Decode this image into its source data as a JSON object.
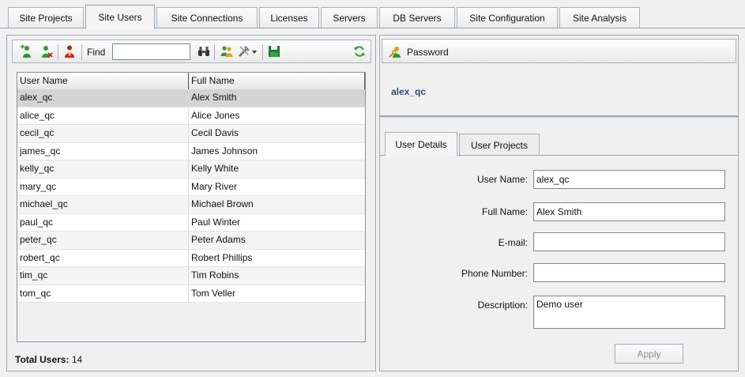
{
  "top_tabs": [
    {
      "label": "Site Projects"
    },
    {
      "label": "Site Users"
    },
    {
      "label": "Site Connections"
    },
    {
      "label": "Licenses"
    },
    {
      "label": "Servers"
    },
    {
      "label": "DB Servers"
    },
    {
      "label": "Site Configuration"
    },
    {
      "label": "Site Analysis"
    }
  ],
  "active_top_tab": "Site Users",
  "toolbar": {
    "find_label": "Find",
    "find_value": "",
    "icons": [
      "add-user-icon",
      "delete-user-icon",
      "user-properties-icon",
      "find-binoculars-icon",
      "users-group-icon",
      "tools-icon",
      "dropdown-arrow-icon",
      "save-icon",
      "refresh-icon"
    ]
  },
  "grid": {
    "headers": [
      "User Name",
      "Full Name"
    ],
    "rows": [
      [
        "alex_qc",
        "Alex Smith"
      ],
      [
        "alice_qc",
        "Alice Jones"
      ],
      [
        "cecil_qc",
        "Cecil Davis"
      ],
      [
        "james_qc",
        "James Johnson"
      ],
      [
        "kelly_qc",
        "Kelly White"
      ],
      [
        "mary_qc",
        "Mary River"
      ],
      [
        "michael_qc",
        "Michael Brown"
      ],
      [
        "paul_qc",
        "Paul Winter"
      ],
      [
        "peter_qc",
        "Peter Adams"
      ],
      [
        "robert_qc",
        "Robert Phillips"
      ],
      [
        "tim_qc",
        "Tim Robins"
      ],
      [
        "tom_qc",
        "Tom Veller"
      ]
    ],
    "selected_row": 0
  },
  "footer": {
    "total_label": "Total Users:",
    "total_value": "14"
  },
  "right": {
    "password_label": "Password",
    "selected_user": "alex_qc",
    "subtabs": [
      {
        "label": "User Details"
      },
      {
        "label": "User Projects"
      }
    ],
    "form": {
      "user_name_label": "User Name:",
      "user_name_value": "alex_qc",
      "full_name_label": "Full Name:",
      "full_name_value": "Alex Smith",
      "email_label": "E-mail:",
      "email_value": "",
      "phone_label": "Phone Number:",
      "phone_value": "",
      "description_label": "Description:",
      "description_value": "Demo user"
    },
    "apply_label": "Apply"
  },
  "colors": {
    "selected_row": "#d4d4d4",
    "selected_user_text": "#2b4a76",
    "icon_green": "#2e9b32",
    "icon_red": "#c8231f"
  }
}
